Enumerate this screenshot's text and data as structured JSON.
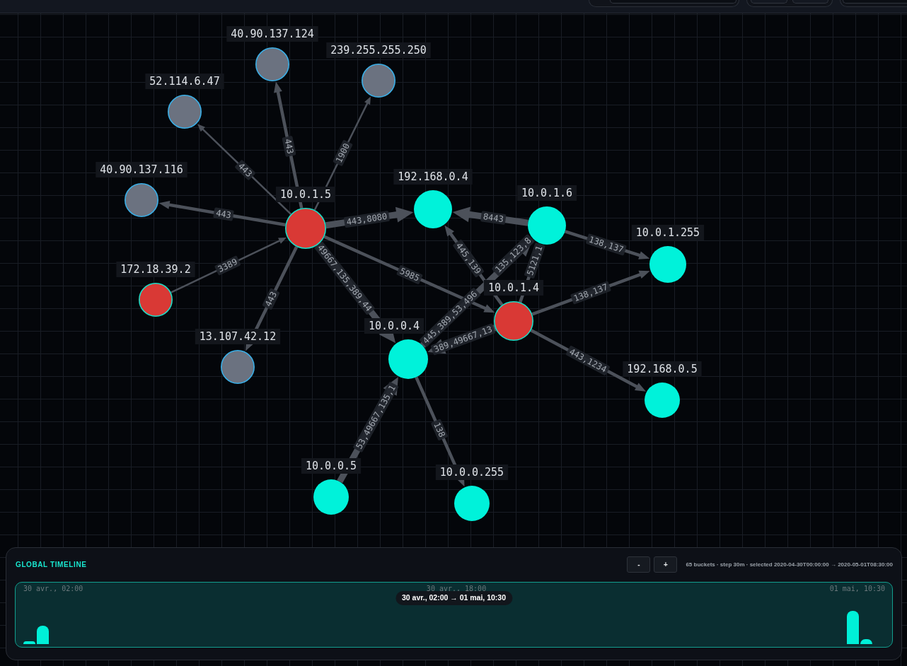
{
  "toolbar": {
    "groups": [
      {
        "controls": [
          {
            "kind": "field"
          }
        ]
      },
      {
        "controls": [
          {
            "kind": "button"
          },
          {
            "kind": "button"
          }
        ]
      },
      {
        "controls": [
          {
            "kind": "field"
          }
        ]
      }
    ]
  },
  "graph": {
    "nodes": [
      {
        "label": "40.90.137.124",
        "color": "#6b7280",
        "kind": "remote"
      },
      {
        "label": "239.255.255.250",
        "color": "#6b7280",
        "kind": "remote"
      },
      {
        "label": "52.114.6.47",
        "color": "#6b7280",
        "kind": "remote"
      },
      {
        "label": "40.90.137.116",
        "color": "#6b7280",
        "kind": "remote"
      },
      {
        "label": "192.168.0.4",
        "color": "#00f2da",
        "kind": "local"
      },
      {
        "label": "10.0.1.5",
        "color": "#d93935",
        "kind": "flagged"
      },
      {
        "label": "10.0.1.6",
        "color": "#00f2da",
        "kind": "local"
      },
      {
        "label": "10.0.1.255",
        "color": "#00f2da",
        "kind": "local"
      },
      {
        "label": "172.18.39.2",
        "color": "#d93935",
        "kind": "flagged"
      },
      {
        "label": "10.0.1.4",
        "color": "#d93935",
        "kind": "flagged"
      },
      {
        "label": "10.0.0.4",
        "color": "#00f2da",
        "kind": "local"
      },
      {
        "label": "13.107.42.12",
        "color": "#6b7280",
        "kind": "remote"
      },
      {
        "label": "192.168.0.5",
        "color": "#00f2da",
        "kind": "local"
      },
      {
        "label": "10.0.0.5",
        "color": "#00f2da",
        "kind": "local"
      },
      {
        "label": "10.0.0.255",
        "color": "#00f2da",
        "kind": "local"
      }
    ],
    "edges": [
      {
        "labels": [
          "443"
        ],
        "kind": "medium"
      },
      {
        "labels": [
          "1900"
        ],
        "kind": "thin"
      },
      {
        "labels": [
          "443"
        ],
        "kind": "thin"
      },
      {
        "labels": [
          "443"
        ],
        "kind": "medium"
      },
      {
        "labels": [
          "3389"
        ],
        "kind": "thin"
      },
      {
        "labels": [
          "443"
        ],
        "kind": "medium"
      },
      {
        "labels": [
          "443,8080"
        ],
        "kind": "thick"
      },
      {
        "labels": [
          "8443"
        ],
        "kind": "thick"
      },
      {
        "labels": [
          "5985"
        ],
        "kind": "medium"
      },
      {
        "labels": [
          "49667,135,389,44"
        ],
        "kind": "thick"
      },
      {
        "labels": [
          "445,139"
        ],
        "kind": "medium"
      },
      {
        "labels": [
          "445,389,53,496",
          "135,123,8"
        ],
        "kind": "thick"
      },
      {
        "labels": [
          "5121,1"
        ],
        "kind": "medium"
      },
      {
        "labels": [
          "389,49667,13"
        ],
        "kind": "thick"
      },
      {
        "labels": [
          "138,137"
        ],
        "kind": "medium"
      },
      {
        "labels": [
          "138,137"
        ],
        "kind": "medium"
      },
      {
        "labels": [
          "443,1234"
        ],
        "kind": "medium"
      },
      {
        "labels": [
          "138"
        ],
        "kind": "medium"
      },
      {
        "labels": [
          "53,49667,135,1"
        ],
        "kind": "thick"
      }
    ]
  },
  "timeline": {
    "title": "GLOBAL TIMELINE",
    "buttons": [
      "-",
      "+"
    ],
    "summary": "65 buckets · step 30m · selected 2020-04-30T00:00:00 → 2020-05-01T08:30:00",
    "axis_labels": [
      "30 avr., 02:00",
      "30 avr., 18:00",
      "01 mai, 10:30"
    ],
    "range_label": "30 avr., 02:00 → 01 mai, 10:30"
  }
}
